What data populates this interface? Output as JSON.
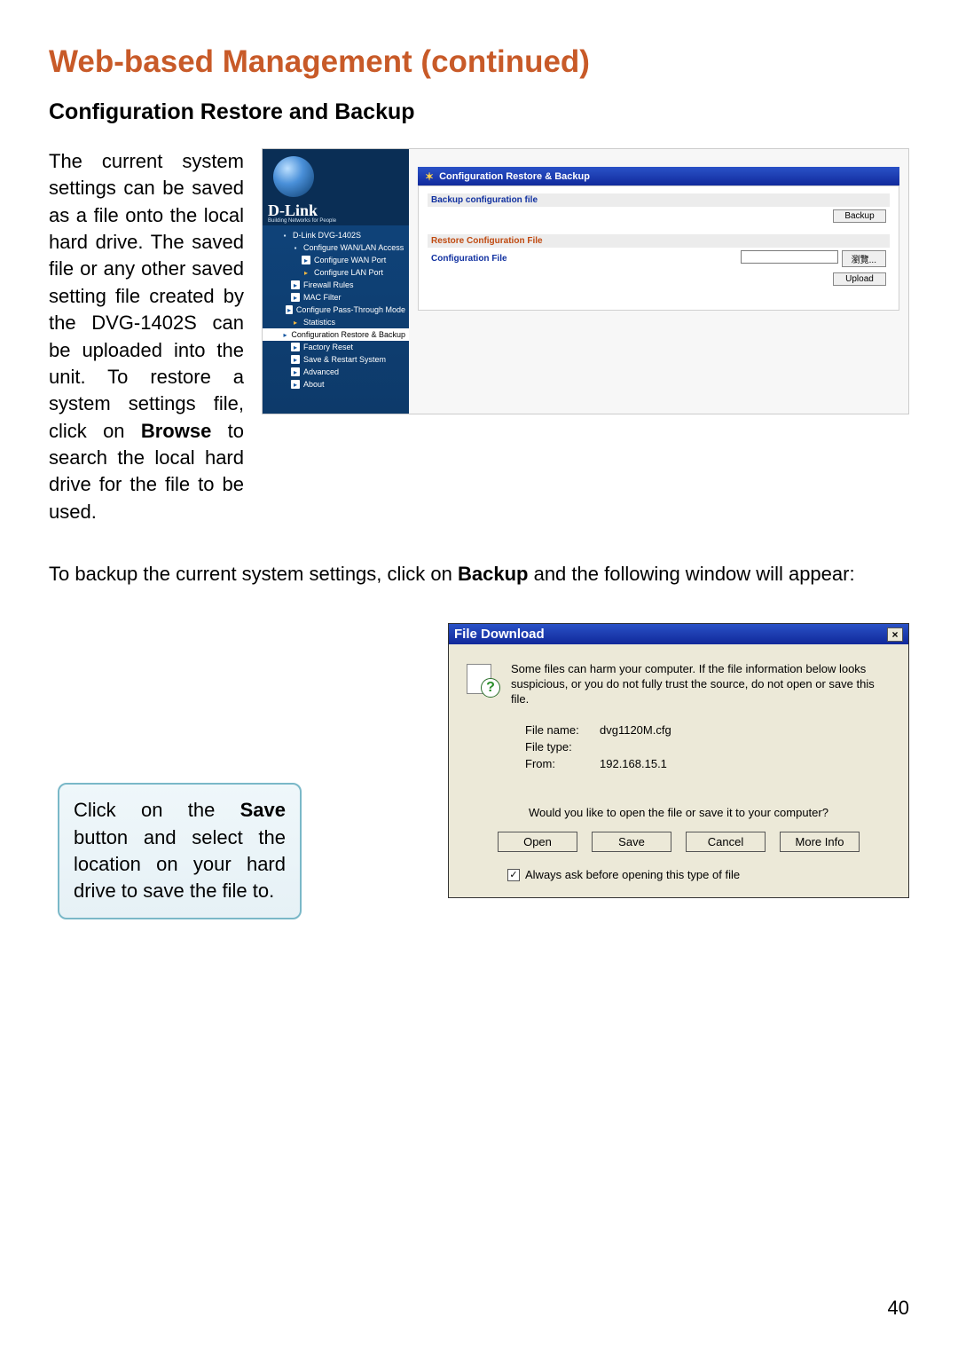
{
  "title": "Web-based Management (continued)",
  "section": "Configuration Restore and Backup",
  "para1_a": "The current system settings can be saved as a file onto the local hard drive. The saved file or any other saved setting file created by the DVG-1402S can be uploaded into the unit. To restore a system settings file, click on ",
  "para1_b": "Browse",
  "para1_c": " to search the local hard drive for the file to be used.",
  "para2_a": "To backup the current system settings, click on ",
  "para2_b": "Backup",
  "para2_c": " and the following window will appear:",
  "callout_a": "Click on the ",
  "callout_b": "Save",
  "callout_c": " button and select the location on your hard drive to save the file to.",
  "router": {
    "brand": "D-Link",
    "tagline": "Building Networks for People",
    "tree": [
      {
        "indent": 1,
        "icon": "device",
        "label": "D-Link DVG-1402S"
      },
      {
        "indent": 2,
        "icon": "device",
        "label": "Configure WAN/LAN Access"
      },
      {
        "indent": 3,
        "icon": "pg",
        "label": "Configure WAN Port"
      },
      {
        "indent": 3,
        "icon": "folder",
        "label": "Configure LAN Port"
      },
      {
        "indent": 2,
        "icon": "pg",
        "label": "Firewall Rules"
      },
      {
        "indent": 2,
        "icon": "pg",
        "label": "MAC Filter"
      },
      {
        "indent": 2,
        "icon": "pg",
        "label": "Configure Pass-Through Mode"
      },
      {
        "indent": 2,
        "icon": "folder",
        "label": "Statistics"
      },
      {
        "indent": 2,
        "icon": "pg",
        "label": "Configuration Restore & Backup",
        "selected": true
      },
      {
        "indent": 2,
        "icon": "pg",
        "label": "Factory Reset"
      },
      {
        "indent": 2,
        "icon": "pg",
        "label": "Save & Restart System"
      },
      {
        "indent": 2,
        "icon": "pg",
        "label": "Advanced"
      },
      {
        "indent": 2,
        "icon": "pg",
        "label": "About"
      }
    ],
    "panel_title": "Configuration Restore & Backup",
    "backup_label": "Backup configuration file",
    "backup_button": "Backup",
    "restore_header": "Restore Configuration File",
    "restore_label": "Configuration File",
    "browse_button": "瀏覽...",
    "upload_button": "Upload"
  },
  "dialog": {
    "title": "File Download",
    "warn": "Some files can harm your computer. If the file information below looks suspicious, or you do not fully trust the source, do not open or save this file.",
    "meta": {
      "filename_label": "File name:",
      "filename_value": "dvg1120M.cfg",
      "filetype_label": "File type:",
      "filetype_value": "",
      "from_label": "From:",
      "from_value": "192.168.15.1"
    },
    "prompt": "Would you like to open the file or save it to your computer?",
    "buttons": {
      "open": "Open",
      "save": "Save",
      "cancel": "Cancel",
      "more": "More Info"
    },
    "checkbox": "Always ask before opening this type of file"
  },
  "page_number": "40"
}
